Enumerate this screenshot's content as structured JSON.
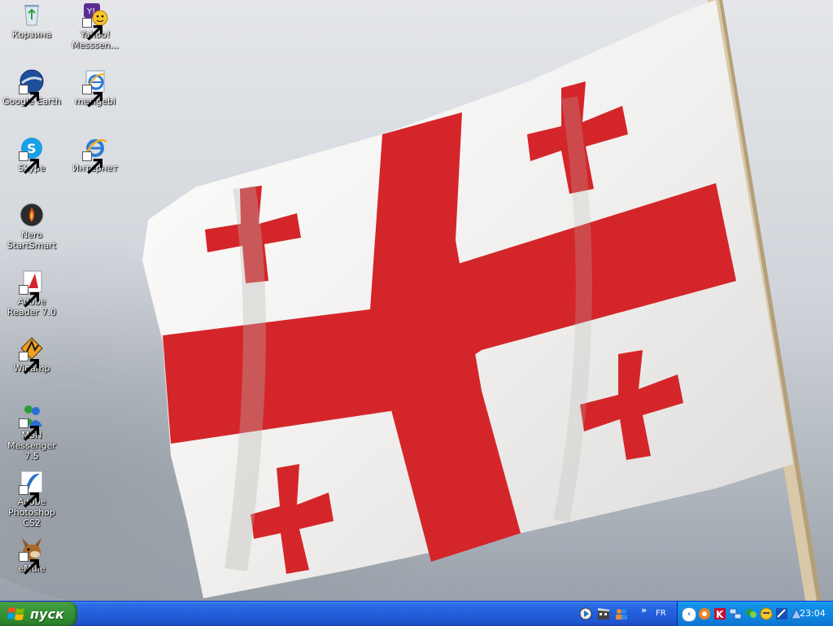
{
  "desktop": {
    "icons": [
      {
        "label": "Корзина",
        "icon": "recycle-bin-icon"
      },
      {
        "label": "Yahoo! Messsen...",
        "icon": "yahoo-messenger-icon"
      },
      {
        "label": "Google Earth",
        "icon": "google-earth-icon"
      },
      {
        "label": "mesigebi",
        "icon": "internet-explorer-icon"
      },
      {
        "label": "Skype",
        "icon": "skype-icon"
      },
      {
        "label": "Интернет",
        "icon": "internet-explorer-icon"
      },
      {
        "label": "Nero StartSmart",
        "icon": "nero-icon"
      },
      {
        "label": "Adobe Reader 7.0",
        "icon": "adobe-reader-icon"
      },
      {
        "label": "Winamp",
        "icon": "winamp-icon"
      },
      {
        "label": "MSN Messenger 7.5",
        "icon": "msn-messenger-icon"
      },
      {
        "label": "Adobe Photoshop CS2",
        "icon": "photoshop-icon"
      },
      {
        "label": "eMule",
        "icon": "emule-icon"
      }
    ],
    "wallpaper": {
      "subject": "flag-of-georgia",
      "colors": {
        "field": "#f4f3f1",
        "cross": "#d4262a",
        "sky": "#d6d9de"
      }
    }
  },
  "taskbar": {
    "start_label": "пуск",
    "quick_launch": [
      "media-player-icon",
      "movie-maker-icon",
      "people-icon"
    ],
    "chevron": "»",
    "language": "FR",
    "tray_icons": [
      "avast-icon",
      "kaspersky-icon",
      "network-icon",
      "messenger-status-icon",
      "yahoo-icon",
      "skype-tray-icon",
      "network-tray-icon"
    ],
    "clock": "23:04",
    "colors": {
      "bar": "#245edb",
      "start": "#3c9a3c",
      "tray": "#0f86e2"
    }
  }
}
